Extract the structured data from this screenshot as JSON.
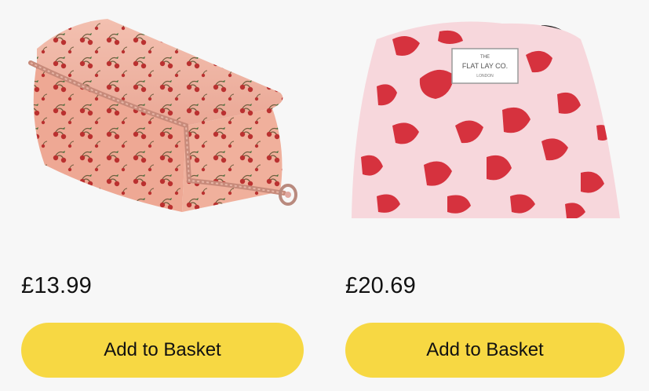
{
  "products": [
    {
      "price": "£13.99",
      "button_label": "Add to Basket",
      "image_icon": "cherry-print-makeup-bag"
    },
    {
      "price": "£20.69",
      "button_label": "Add to Basket",
      "image_icon": "leopard-print-drawstring-bag",
      "label_text": [
        "THE",
        "FLAT LAY CO.",
        "LONDON"
      ]
    }
  ],
  "colors": {
    "button": "#f7d843",
    "background": "#f7f7f7",
    "bag_pink": "#f0b3a3",
    "leopard_red": "#d6323e"
  }
}
